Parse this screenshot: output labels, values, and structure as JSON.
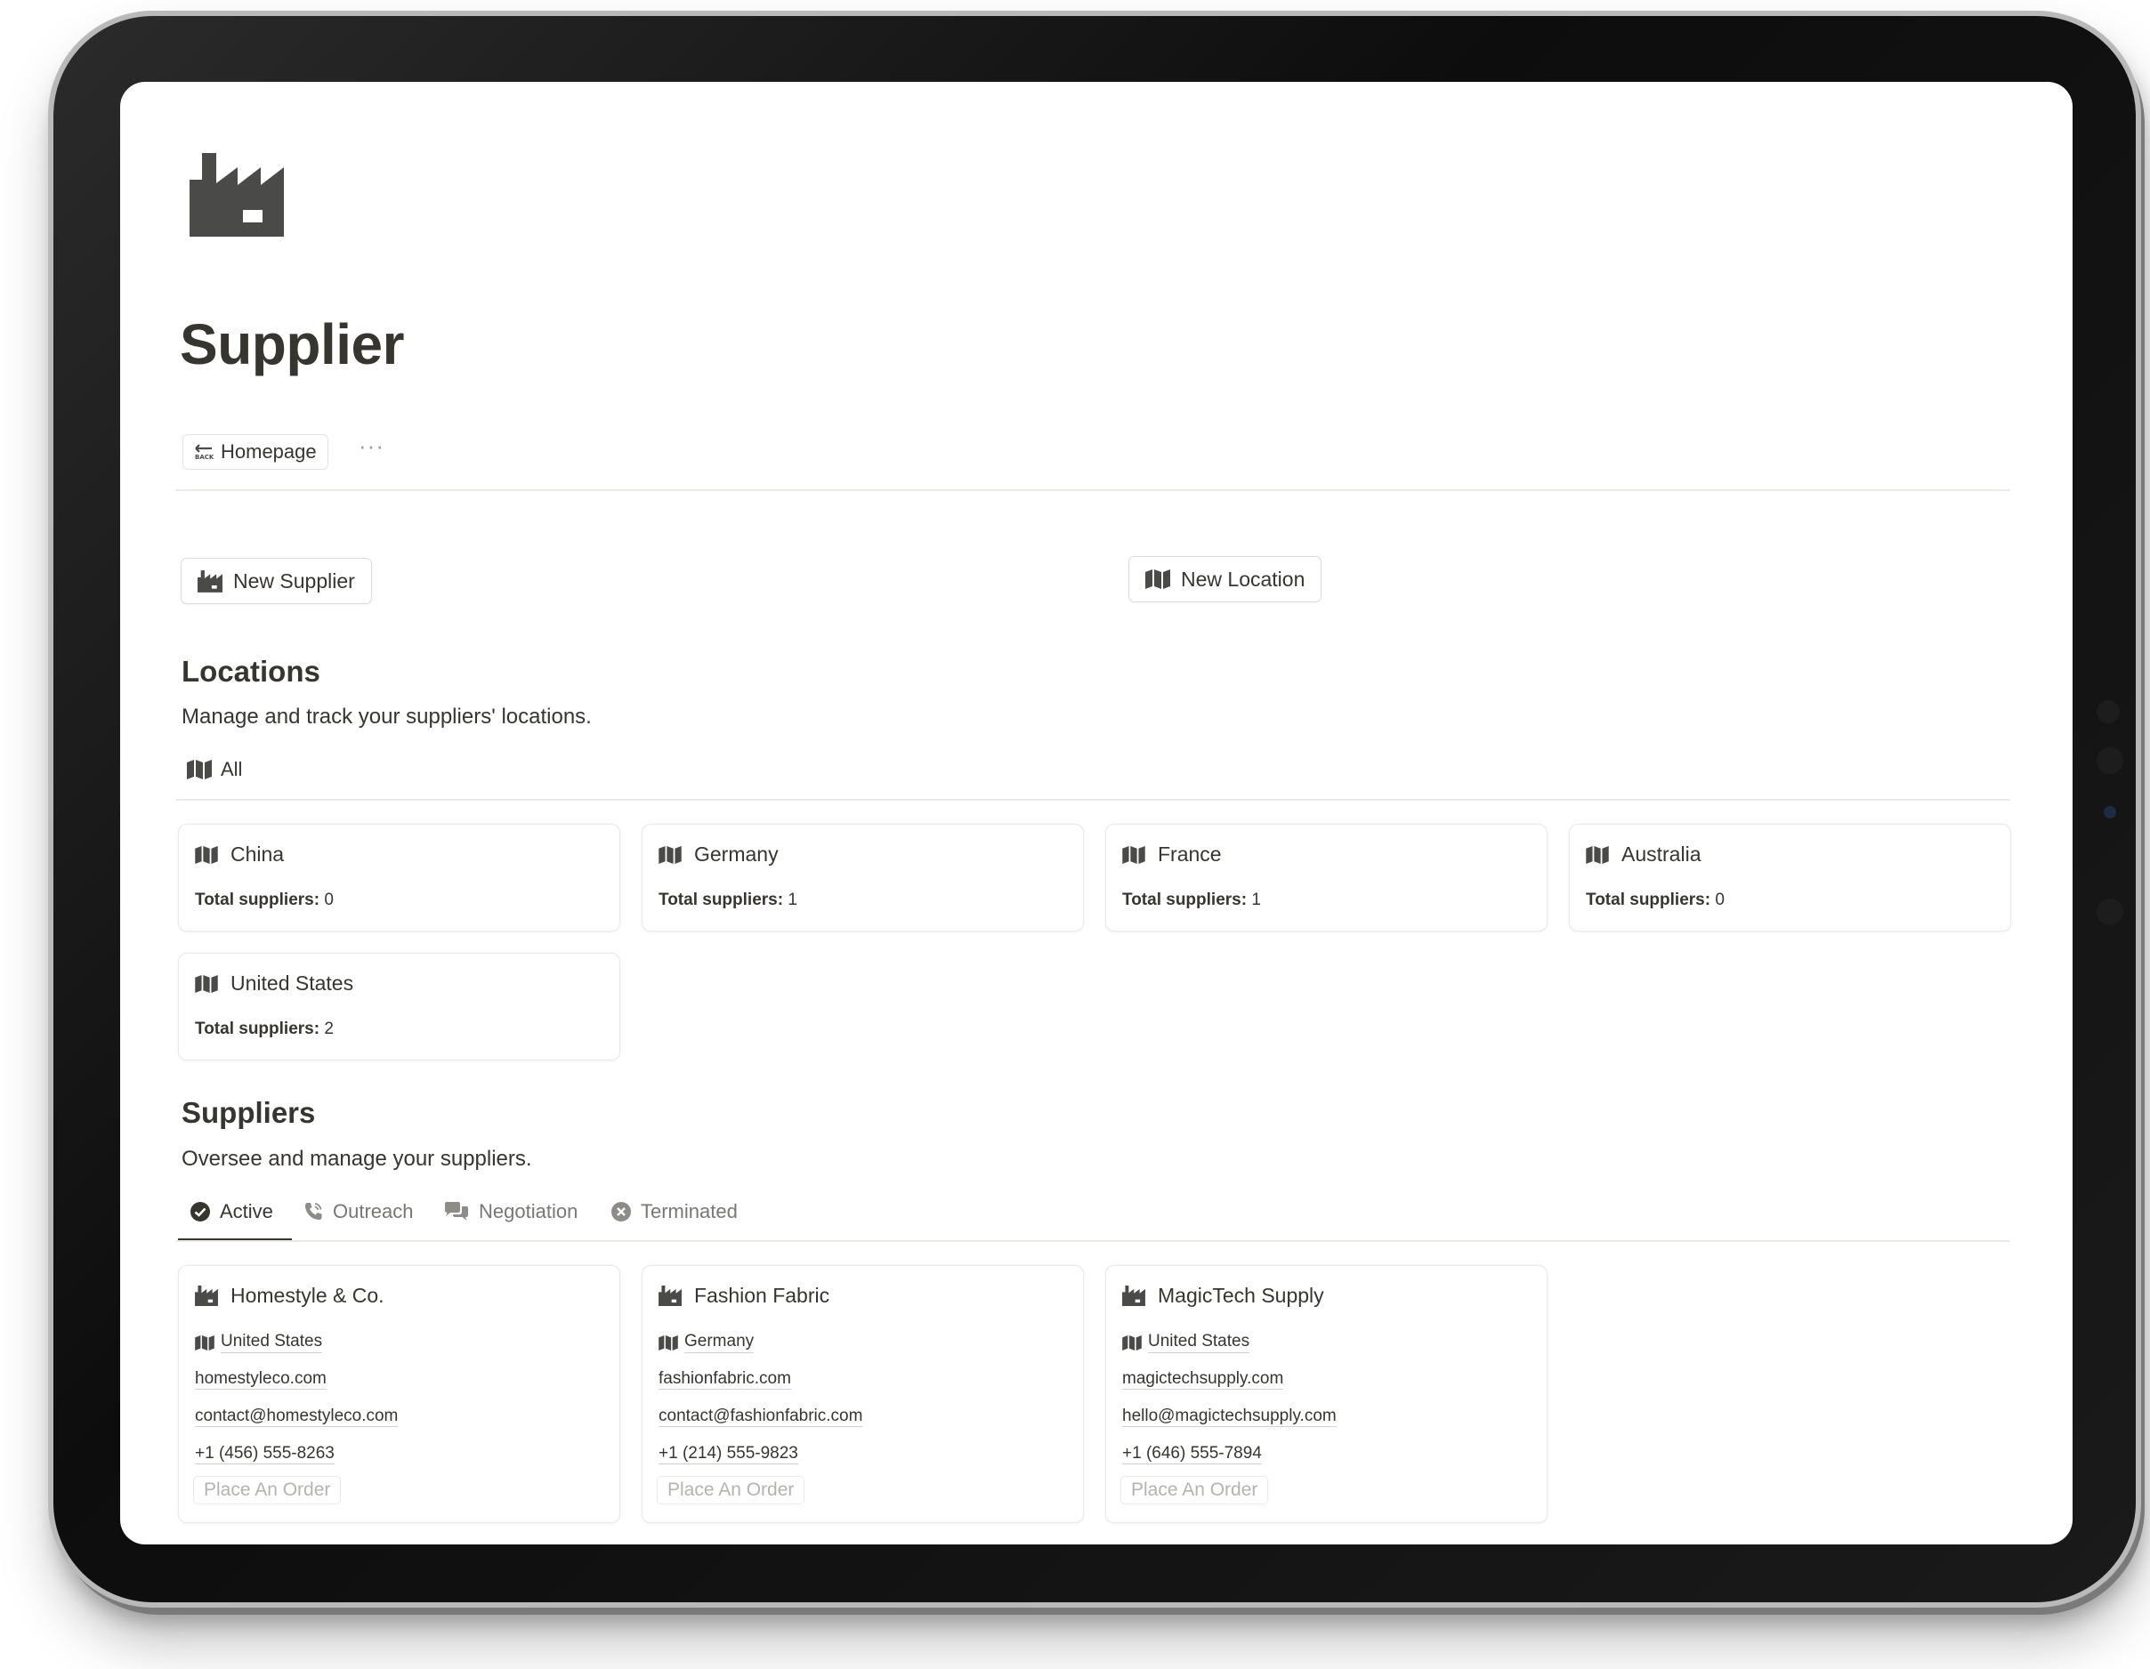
{
  "page": {
    "title": "Supplier",
    "icon": "factory-icon"
  },
  "breadcrumb": {
    "back_label": "Homepage",
    "back_icon": "back-arrow-icon",
    "more_label": "···"
  },
  "actions": {
    "new_supplier": "New Supplier",
    "new_location": "New Location"
  },
  "locations": {
    "title": "Locations",
    "description": "Manage and track your suppliers' locations.",
    "view_tab": "All",
    "total_label": "Total suppliers:",
    "items": [
      {
        "name": "China",
        "total": "0"
      },
      {
        "name": "Germany",
        "total": "1"
      },
      {
        "name": "France",
        "total": "1"
      },
      {
        "name": "Australia",
        "total": "0"
      },
      {
        "name": "United States",
        "total": "2"
      }
    ]
  },
  "suppliers": {
    "title": "Suppliers",
    "description": "Oversee and manage your suppliers.",
    "tabs": [
      {
        "label": "Active",
        "icon": "check-circle-icon",
        "active": true
      },
      {
        "label": "Outreach",
        "icon": "phone-icon",
        "active": false
      },
      {
        "label": "Negotiation",
        "icon": "chat-bubbles-icon",
        "active": false
      },
      {
        "label": "Terminated",
        "icon": "x-circle-icon",
        "active": false
      }
    ],
    "order_label": "Place An Order",
    "items": [
      {
        "name": "Homestyle & Co.",
        "location": "United States",
        "website": "homestyleco.com",
        "email": "contact@homestyleco.com",
        "phone": "+1 (456) 555-8263"
      },
      {
        "name": "Fashion Fabric",
        "location": "Germany",
        "website": "fashionfabric.com",
        "email": "contact@fashionfabric.com",
        "phone": "+1 (214) 555-9823"
      },
      {
        "name": "MagicTech Supply",
        "location": "United States",
        "website": "magictechsupply.com",
        "email": "hello@magictechsupply.com",
        "phone": "+1 (646) 555-7894"
      }
    ]
  },
  "colors": {
    "text": "#37352f",
    "muted": "#787774",
    "border": "#e9e9e7",
    "icon": "#4a4a48"
  }
}
